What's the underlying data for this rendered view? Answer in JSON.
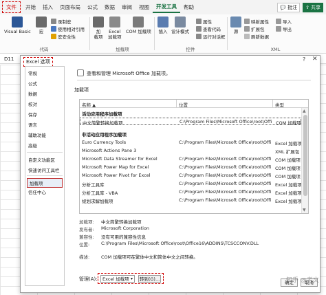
{
  "colors": {
    "accent": "#1a7343",
    "highlight": "#d00000"
  },
  "tabs": [
    {
      "label": "文件",
      "state": "file"
    },
    {
      "label": "开始",
      "state": ""
    },
    {
      "label": "插入",
      "state": ""
    },
    {
      "label": "页面布局",
      "state": ""
    },
    {
      "label": "公式",
      "state": ""
    },
    {
      "label": "数据",
      "state": ""
    },
    {
      "label": "审阅",
      "state": ""
    },
    {
      "label": "视图",
      "state": ""
    },
    {
      "label": "开发工具",
      "state": "active"
    },
    {
      "label": "帮助",
      "state": ""
    }
  ],
  "tabbar_right": {
    "comments": "批注",
    "share": "共享"
  },
  "ribbon": {
    "vb": "Visual Basic",
    "macro": "宏",
    "record_macro": "录制宏",
    "relative_ref": "使用相对引用",
    "macro_security": "宏安全性",
    "group_code": "代码",
    "addins": "加\n载项",
    "excel_addins": "Excel\n加载项",
    "com_addins": "COM 加载项",
    "group_addins": "加载项",
    "insert": "插入",
    "design_mode": "设计模式",
    "properties": "属性",
    "view_code": "查看代码",
    "run_dialog": "运行对话框",
    "group_controls": "控件",
    "source": "源",
    "map_props": "映射属性",
    "expansion": "扩展包",
    "refresh": "刷新数据",
    "import": "导入",
    "export": "导出",
    "group_xml": "XML"
  },
  "formula_bar": {
    "cell": "D11"
  },
  "dialog": {
    "title": "Excel 选项",
    "help": "?",
    "close": "✕",
    "nav": [
      "常规",
      "公式",
      "数据",
      "校对",
      "保存",
      "语言",
      "辅助功能",
      "高级",
      "自定义功能区",
      "快速访问工具栏",
      "加载项",
      "信任中心"
    ],
    "header": "查看和管理 Microsoft Office 加载项。",
    "section": "加载项",
    "table": {
      "col_name": "名称 ▲",
      "col_location": "位置",
      "col_type": "类型",
      "group_active": "活动应用程序加载项",
      "active_rows": [
        {
          "name": "中文简繁转换加载项",
          "loc": "C:\\Program Files\\Microsoft Office\\root\\Offi",
          "type": "COM 加载项"
        }
      ],
      "group_inactive": "非活动应用程序加载项",
      "inactive_rows": [
        {
          "name": "Euro Currency Tools",
          "loc": "C:\\Program Files\\Microsoft Office\\root\\Offic",
          "type": "Excel 加载项"
        },
        {
          "name": "Microsoft Actions Pane 3",
          "loc": "",
          "type": "XML 扩展包"
        },
        {
          "name": "Microsoft Data Streamer for Excel",
          "loc": "C:\\Program Files\\Microsoft Office\\root\\Offic",
          "type": "COM 加载项"
        },
        {
          "name": "Microsoft Power Map for Excel",
          "loc": "C:\\Program Files\\Microsoft Office\\root\\Offic",
          "type": "COM 加载项"
        },
        {
          "name": "Microsoft Power Pivot for Excel",
          "loc": "C:\\Program Files\\Microsoft Office\\root\\Offic",
          "type": "COM 加载项"
        },
        {
          "name": "分析工具库",
          "loc": "C:\\Program Files\\Microsoft Office\\root\\Offic",
          "type": "Excel 加载项"
        },
        {
          "name": "分析工具库 - VBA",
          "loc": "C:\\Program Files\\Microsoft Office\\root\\Offic",
          "type": "Excel 加载项"
        },
        {
          "name": "规划求解加载项",
          "loc": "C:\\Program Files\\Microsoft Office\\root\\Offic",
          "type": "Excel 加载项"
        }
      ]
    },
    "details": {
      "addin_label": "加载项:",
      "addin_value": "中文简繁转换加载项",
      "publisher_label": "发布者:",
      "publisher_value": "Microsoft Corporation",
      "compat_label": "兼容性:",
      "compat_value": "没有可用的兼容性信息",
      "location_label": "位置:",
      "location_value": "C:\\Program Files\\Microsoft Office\\root\\Office16\\ADDINS\\TCSCCONV.DLL",
      "desc_label": "描述:",
      "desc_value": "COM 加载项可在繁体中文和简体中文之间转换。"
    },
    "manage_label": "管理(A):",
    "manage_select": "Excel 加载项",
    "go_button": "转到(G)...",
    "ok": "确定",
    "cancel": "取消"
  },
  "watermark": "知乎 @老文"
}
